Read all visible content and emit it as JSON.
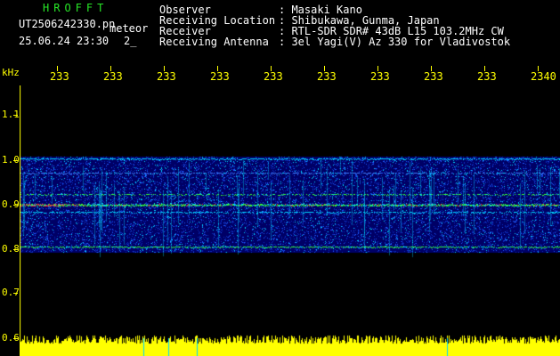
{
  "header": {
    "title": "HROFFT",
    "filename": "UT2506242330.pn",
    "type_label": "meteor",
    "datetime": "25.06.24 23:30",
    "count": "2_",
    "fields": [
      {
        "label": "Observer",
        "value": ": Masaki Kano"
      },
      {
        "label": "Receiving Location",
        "value": ": Shibukawa, Gunma, Japan"
      },
      {
        "label": "Receiver",
        "value": ": RTL-SDR SDR# 43dB L15 103.2MHz CW"
      },
      {
        "label": "Receiving Antenna",
        "value": ": 3el Yagi(V) Az 330 for Vladivostok"
      }
    ]
  },
  "x_axis": {
    "ticks": [
      "233",
      "233",
      "233",
      "233",
      "233",
      "233",
      "233",
      "233",
      "233",
      "2340"
    ]
  },
  "y_axis": {
    "unit": "kHz",
    "ticks": [
      "1.1",
      "1.0",
      "0.9",
      "0.8",
      "0.7",
      "0.6"
    ]
  },
  "colors": {
    "text": "#ffffff",
    "title": "#27e627",
    "axis": "#ffff00",
    "background": "#000000",
    "signal_band": "#000066",
    "intensity_low": "#0a2dbe",
    "intensity_mid": "#00d8ff",
    "intensity_high": "#33ff33",
    "intensity_peak": "#ff3030",
    "level_meter": "#ffff00"
  }
}
